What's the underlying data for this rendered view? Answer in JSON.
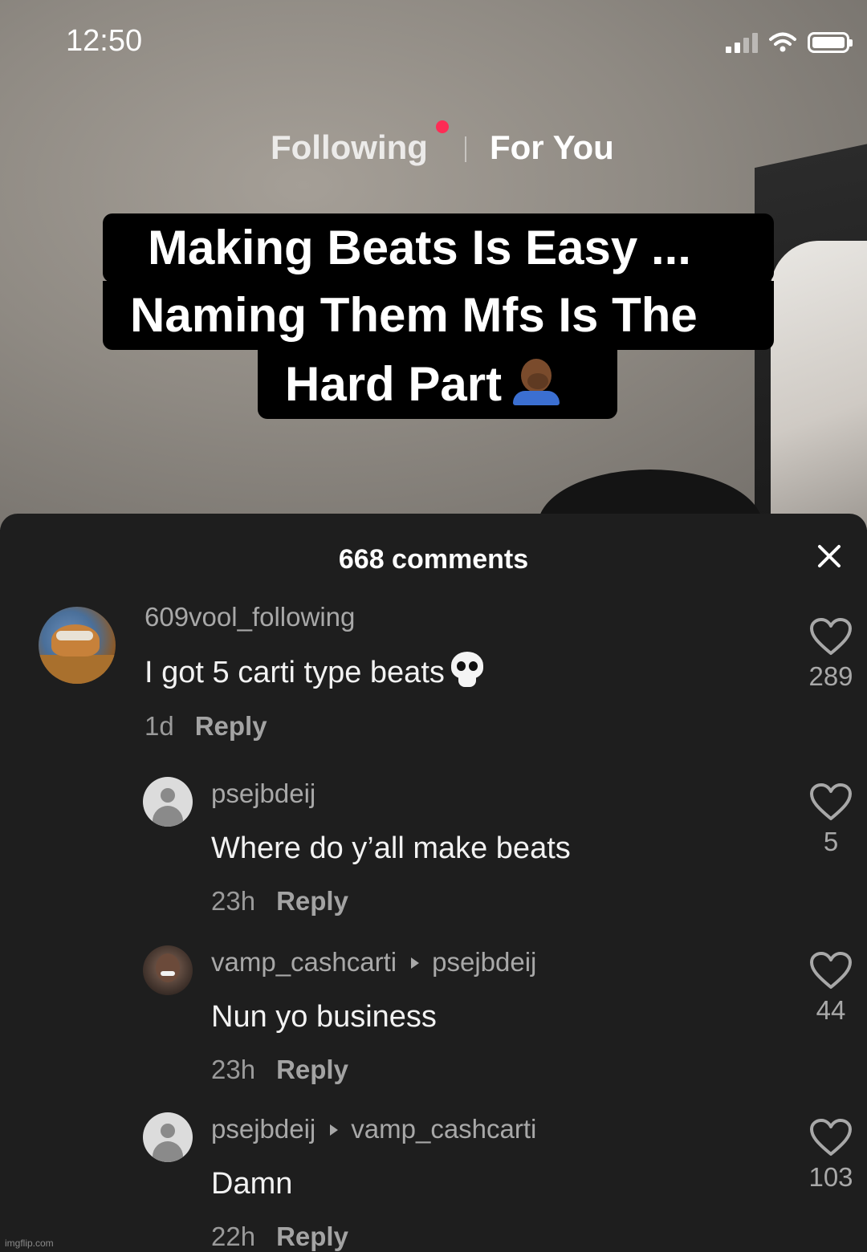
{
  "status_bar": {
    "time": "12:50"
  },
  "tabs": {
    "following": "Following",
    "for_you": "For You"
  },
  "caption": {
    "line1": "Making Beats Is Easy ...",
    "line2": "Naming Them Mfs Is The",
    "line3": "Hard Part"
  },
  "sheet": {
    "title": "668 comments"
  },
  "comments": [
    {
      "username": "609vool_following",
      "text": "I got 5 carti type beats",
      "time": "1d",
      "reply_label": "Reply",
      "likes": "289",
      "avatar": "cartoon-avatar"
    },
    {
      "username": "psejbdeij",
      "text": "Where do y’all make beats",
      "time": "23h",
      "reply_label": "Reply",
      "likes": "5",
      "avatar": "default-avatar"
    },
    {
      "username": "vamp_cashcarti",
      "reply_to": "psejbdeij",
      "text": "Nun yo business",
      "time": "23h",
      "reply_label": "Reply",
      "likes": "44",
      "avatar": "photo-avatar"
    },
    {
      "username": "psejbdeij",
      "reply_to": "vamp_cashcarti",
      "text": "Damn",
      "time": "22h",
      "reply_label": "Reply",
      "likes": "103",
      "avatar": "default-avatar"
    }
  ],
  "watermark": "imgflip.com",
  "colors": {
    "notification_dot": "#fe2c55",
    "sheet_bg": "#1e1e1e"
  }
}
